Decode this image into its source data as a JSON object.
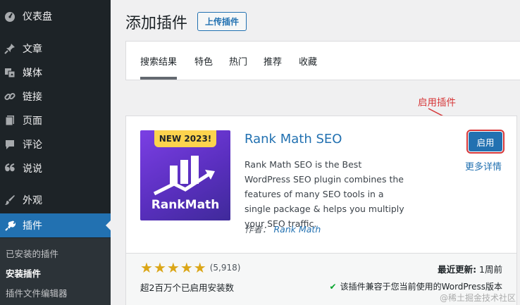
{
  "sidebar": {
    "items": [
      {
        "label": "仪表盘",
        "icon": "dashboard-icon"
      },
      {
        "label": "文章",
        "icon": "pin-icon"
      },
      {
        "label": "媒体",
        "icon": "media-icon"
      },
      {
        "label": "链接",
        "icon": "link-icon"
      },
      {
        "label": "页面",
        "icon": "page-icon"
      },
      {
        "label": "评论",
        "icon": "comment-icon"
      },
      {
        "label": "说说",
        "icon": "quote-icon"
      },
      {
        "label": "外观",
        "icon": "brush-icon"
      },
      {
        "label": "插件",
        "icon": "plugin-icon"
      }
    ],
    "submenu": [
      "已安装的插件",
      "安装插件",
      "插件文件编辑器"
    ]
  },
  "header": {
    "title": "添加插件",
    "upload_label": "上传插件"
  },
  "tabs": [
    "搜索结果",
    "特色",
    "热门",
    "推荐",
    "收藏"
  ],
  "plugin": {
    "badge": "NEW 2023!",
    "logo_text": "RankMath",
    "name": "Rank Math SEO",
    "description": "Rank Math SEO is the Best WordPress SEO plugin combines the features of many SEO tools in a single package & helps you multiply your SEO traffic.",
    "author_prefix": "作者：",
    "author": "Rank Math",
    "activate_label": "启用",
    "more_details": "更多详情",
    "rating": 5,
    "rating_count": "(5,918)",
    "installs": "超2百万个已启用安装数",
    "updated_label": "最近更新:",
    "updated_value": "1周前",
    "compat": "该插件兼容于您当前使用的WordPress版本"
  },
  "annotation": "启用插件",
  "watermark": "@稀土掘金技术社区",
  "colors": {
    "accent": "#2271b1",
    "sidebar": "#1d2327",
    "annotation": "#d63638",
    "star": "#dba617"
  }
}
